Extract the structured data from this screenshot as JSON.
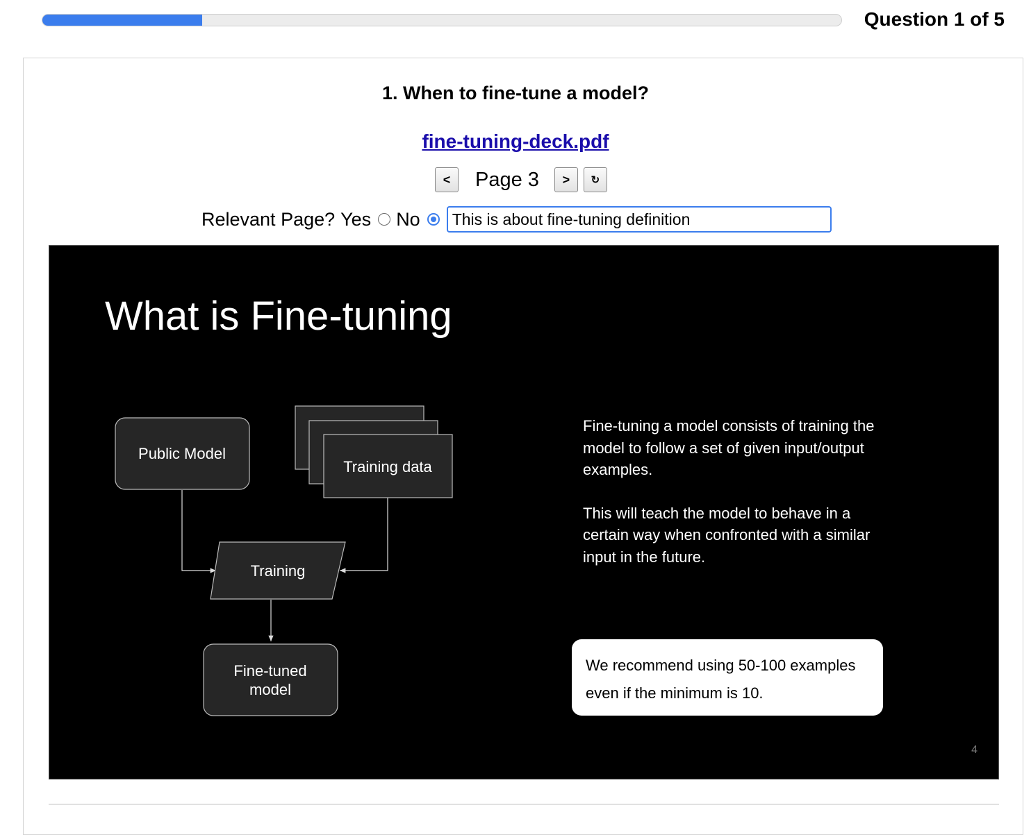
{
  "progress": {
    "fraction": 0.2,
    "label": "Question 1 of 5"
  },
  "question": {
    "title": "1. When to fine-tune a model?"
  },
  "document": {
    "file_name": "fine-tuning-deck.pdf",
    "prev_label": "<",
    "page_label": "Page 3",
    "next_label": ">",
    "reload_label": "↻"
  },
  "relevance": {
    "prompt": "Relevant Page?",
    "yes_label": "Yes",
    "no_label": "No",
    "selected": "No",
    "note_value": "This is about fine-tuning definition"
  },
  "slide": {
    "title": "What is Fine-tuning",
    "nodes": {
      "public_model": "Public Model",
      "training_data": "Training data",
      "training": "Training",
      "fine_tuned_line1": "Fine-tuned",
      "fine_tuned_line2": "model"
    },
    "paragraph1": "Fine-tuning a model consists of training the model to follow a set of given input/output examples.",
    "paragraph2": "This will teach the model to behave in a certain way when confronted with a similar input in the future.",
    "callout": "We recommend using 50-100 examples even if the minimum is 10.",
    "page_number": "4"
  }
}
